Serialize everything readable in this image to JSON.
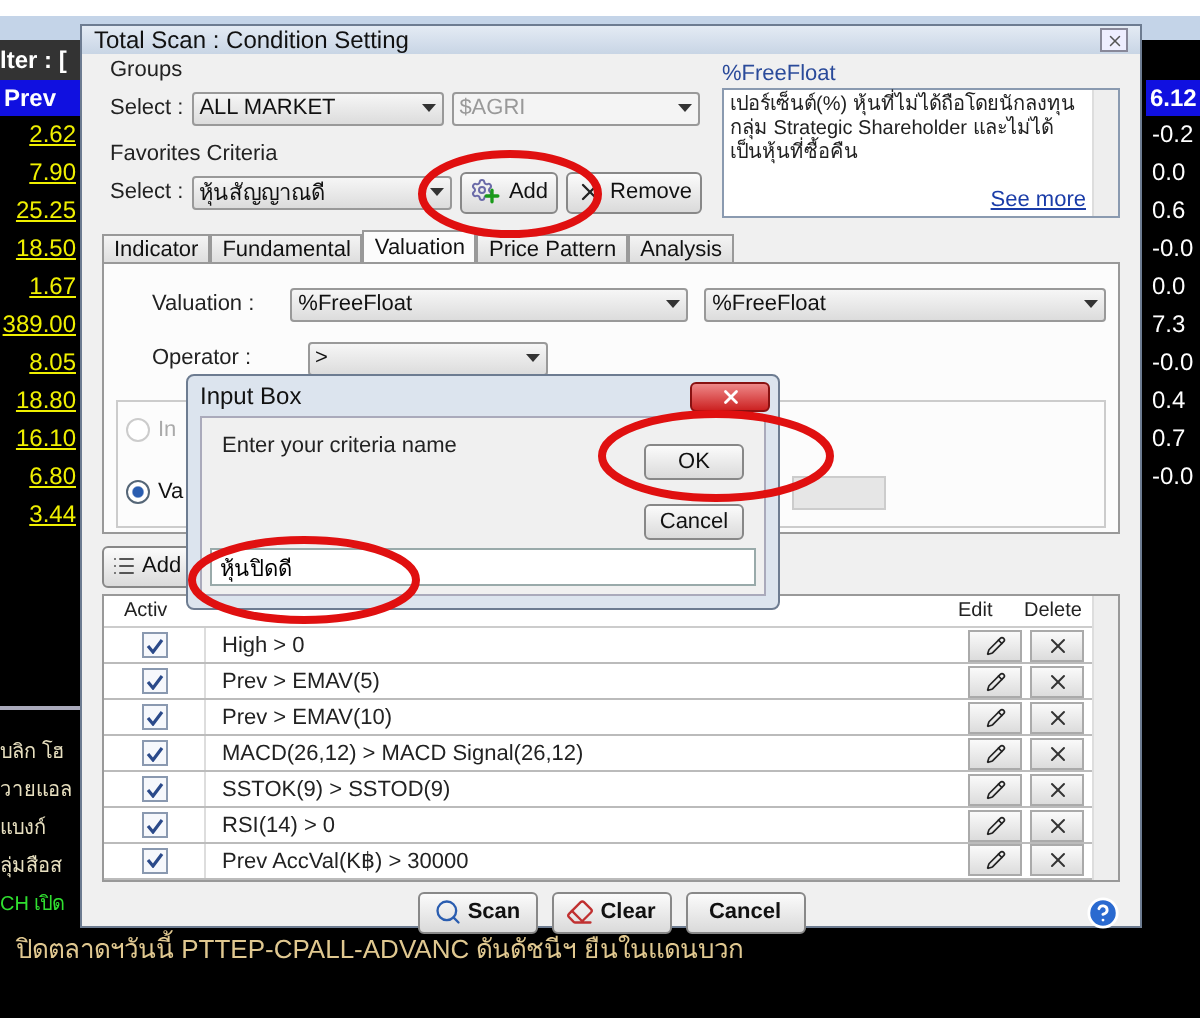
{
  "market": {
    "filter_label": "lter : [",
    "left_header": "Prev",
    "left_values": [
      "2.62",
      "7.90",
      "25.25",
      "18.50",
      "1.67",
      "389.00",
      "8.05",
      "18.80",
      "16.10",
      "6.80",
      "3.44"
    ],
    "right_header": "6.12",
    "right_values": [
      "-0.2",
      "0.0",
      "0.6",
      "-0.0",
      "0.0",
      "7.3",
      "-0.0",
      "0.4",
      "0.7",
      "-0.0"
    ]
  },
  "news": [
    {
      "text": "บลิก โฮ",
      "kind": "plain"
    },
    {
      "text": "วายแอล",
      "kind": "plain"
    },
    {
      "text": "แบงก์",
      "kind": "plain"
    },
    {
      "text": "ลุ่มสือส",
      "kind": "plain"
    },
    {
      "text": "CH เปิด",
      "kind": "highlight"
    }
  ],
  "ticker": "ปิดตลาดฯวันนี้ PTTEP-CPALL-ADVANC ดันดัชนีฯ ยืนในแดนบวก",
  "dialog": {
    "title": "Total Scan : Condition Setting",
    "groups": {
      "label": "Groups",
      "select_label": "Select :",
      "value": "ALL MARKET",
      "secondary_value": "$AGRI"
    },
    "favorites": {
      "label": "Favorites Criteria",
      "select_label": "Select :",
      "value": "หุ้นสัญญาณดี",
      "buttons": [
        {
          "label": "Add",
          "kind": "add"
        },
        {
          "label": "Remove",
          "kind": "remove"
        }
      ]
    },
    "description": {
      "title": "%FreeFloat",
      "text": "เปอร์เซ็นต์(%) หุ้นที่ไม่ได้ถือโดยนักลงทุนกลุ่ม Strategic Shareholder และไม่ได้ เป็นหุ้นที่ซื้อคืน",
      "link": "See more"
    },
    "tabs": [
      {
        "label": "Indicator",
        "selected": false
      },
      {
        "label": "Fundamental",
        "selected": false
      },
      {
        "label": "Valuation",
        "selected": true
      },
      {
        "label": "Price Pattern",
        "selected": false
      },
      {
        "label": "Analysis",
        "selected": false
      }
    ],
    "valuation": {
      "label": "Valuation :",
      "value": "%FreeFloat",
      "second_value": "%FreeFloat",
      "operator_label": "Operator :",
      "operator": ">",
      "radios": [
        {
          "label": "In",
          "selected": false,
          "disabled": true
        },
        {
          "label": "Va",
          "selected": true,
          "disabled": false
        }
      ]
    },
    "add_button": "Add",
    "table": {
      "columns": [
        "Activ",
        "Edit",
        "Delete"
      ],
      "rows": [
        {
          "active": true,
          "condition": "High > 0"
        },
        {
          "active": true,
          "condition": "Prev > EMAV(5)"
        },
        {
          "active": true,
          "condition": "Prev > EMAV(10)"
        },
        {
          "active": true,
          "condition": "MACD(26,12) > MACD Signal(26,12)"
        },
        {
          "active": true,
          "condition": "SSTOK(9) > SSTOD(9)"
        },
        {
          "active": true,
          "condition": "RSI(14) > 0"
        },
        {
          "active": true,
          "condition": "Prev AccVal(K฿) > 30000"
        }
      ]
    },
    "buttons": [
      {
        "label": "Scan",
        "kind": "scan"
      },
      {
        "label": "Clear",
        "kind": "clear"
      },
      {
        "label": "Cancel",
        "kind": "cancel"
      }
    ]
  },
  "input_box": {
    "title": "Input Box",
    "prompt": "Enter your criteria name",
    "value": "หุ้นปิดดี",
    "buttons": [
      "OK",
      "Cancel"
    ]
  }
}
